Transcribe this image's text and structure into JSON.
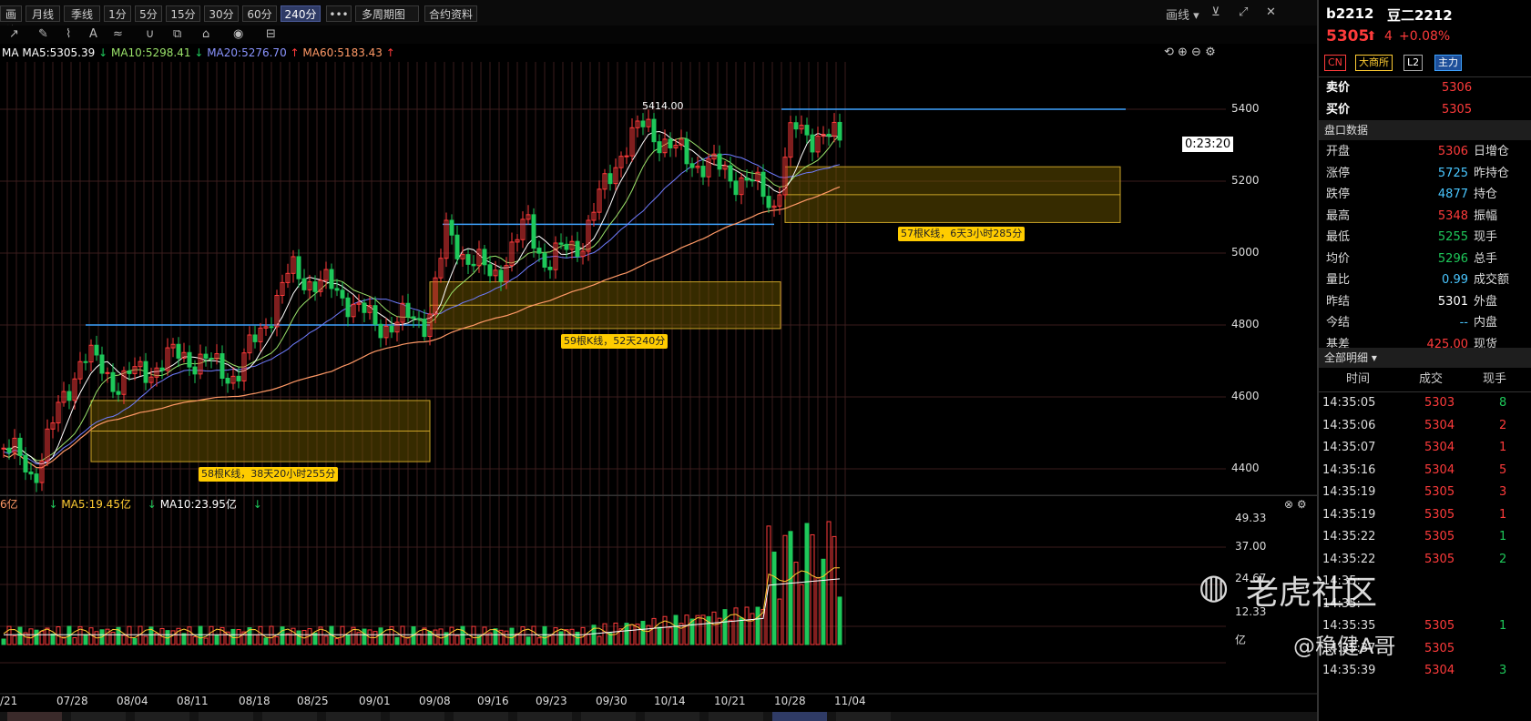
{
  "toolbar": {
    "items": [
      {
        "label": "画线"
      },
      {
        "label": "月线"
      },
      {
        "label": "季线"
      },
      {
        "label": "1分"
      },
      {
        "label": "5分"
      },
      {
        "label": "15分"
      },
      {
        "label": "30分"
      },
      {
        "label": "60分"
      },
      {
        "label": "240分",
        "active": true
      },
      {
        "label": "•••"
      },
      {
        "label": "多周期图"
      },
      {
        "label": "合约资料"
      }
    ],
    "draw_label": "画线",
    "tool_icons": [
      "trend-icon",
      "pen-icon",
      "brush-icon",
      "text-icon",
      "measure-icon",
      "magnet-icon",
      "copy-icon",
      "lock-icon",
      "eye-icon",
      "delete-icon"
    ]
  },
  "ma_bar": {
    "ma_label": "MA",
    "ma5": "MA5:5305.39",
    "ma10": "MA10:5298.41",
    "ma20": "MA20:5276.70",
    "ma60": "MA60:5183.43"
  },
  "colors": {
    "up": "#ff3b3b",
    "down": "#1ec85a",
    "ma5": "#ffffff",
    "ma10": "#9be36a",
    "ma20": "#6f7dff",
    "ma60": "#ff9966",
    "hline": "#3fa3ff",
    "box": "#5a4a00",
    "boxline": "#c9a227"
  },
  "price_axis": {
    "ticks": [
      "5400",
      "5200",
      "5000",
      "4800",
      "4600",
      "4400"
    ]
  },
  "peak_label": "5414.00",
  "countdown": "0:23:20",
  "annotations": {
    "a1": "57根K线，6天3小时285分",
    "a2": "59根K线，52天240分",
    "a3": "58根K线，38天20小时255分"
  },
  "volume": {
    "label_partial": "6亿",
    "ma5": "MA5:19.45亿",
    "ma10": "MA10:23.95亿",
    "ticks": [
      "49.33",
      "37.00",
      "24.67",
      "12.33",
      "亿"
    ]
  },
  "dates": [
    "/21",
    "07/28",
    "08/04",
    "08/11",
    "08/18",
    "08/25",
    "09/01",
    "09/08",
    "09/16",
    "09/23",
    "09/30",
    "10/14",
    "10/21",
    "10/28",
    "11/04"
  ],
  "instrument": {
    "code": "b2212",
    "name": "豆二2212",
    "price": "5305",
    "change": "4",
    "change_pct": "+0.08%",
    "tags": [
      "CN",
      "大商所",
      "L2",
      "主力"
    ]
  },
  "quote": {
    "sell_label": "卖价",
    "sell": "5306",
    "buy_label": "买价",
    "buy": "5305"
  },
  "panel_title": "盘口数据",
  "panel_rows": [
    {
      "k": "开盘",
      "v": "5306",
      "c": "red",
      "k2": "日增仓"
    },
    {
      "k": "涨停",
      "v": "5725",
      "c": "cyan",
      "k2": "昨持仓"
    },
    {
      "k": "跌停",
      "v": "4877",
      "c": "cyan",
      "k2": "持仓"
    },
    {
      "k": "最高",
      "v": "5348",
      "c": "red",
      "k2": "振幅"
    },
    {
      "k": "最低",
      "v": "5255",
      "c": "green",
      "k2": "现手"
    },
    {
      "k": "均价",
      "v": "5296",
      "c": "green",
      "k2": "总手"
    },
    {
      "k": "量比",
      "v": "0.99",
      "c": "cyan",
      "k2": "成交额"
    },
    {
      "k": "昨结",
      "v": "5301",
      "c": "white",
      "k2": "外盘"
    },
    {
      "k": "今结",
      "v": "--",
      "c": "cyan",
      "k2": "内盘"
    },
    {
      "k": "基差",
      "v": "425.00",
      "c": "red",
      "k2": "现货"
    }
  ],
  "detail_title": "全部明细",
  "detail_headers": [
    "时间",
    "成交",
    "现手"
  ],
  "ticks": [
    {
      "t": "14:35:05",
      "p": "5303",
      "q": "8",
      "c": "green"
    },
    {
      "t": "14:35:06",
      "p": "5304",
      "q": "2",
      "c": "red"
    },
    {
      "t": "14:35:07",
      "p": "5304",
      "q": "1",
      "c": "red"
    },
    {
      "t": "14:35:16",
      "p": "5304",
      "q": "5",
      "c": "red"
    },
    {
      "t": "14:35:19",
      "p": "5305",
      "q": "3",
      "c": "red"
    },
    {
      "t": "14:35:19",
      "p": "5305",
      "q": "1",
      "c": "red"
    },
    {
      "t": "14:35:22",
      "p": "5305",
      "q": "1",
      "c": "green"
    },
    {
      "t": "14:35:22",
      "p": "5305",
      "q": "2",
      "c": "green"
    },
    {
      "t": "14:35:",
      "p": "",
      "q": "",
      "c": "red"
    },
    {
      "t": "14:35:",
      "p": "",
      "q": "",
      "c": "red"
    },
    {
      "t": "14:35:35",
      "p": "5305",
      "q": "1",
      "c": "green"
    },
    {
      "t": "14:35:37",
      "p": "5305",
      "q": "",
      "c": "red"
    },
    {
      "t": "14:35:39",
      "p": "5304",
      "q": "3",
      "c": "green"
    }
  ],
  "watermark": {
    "brand": "老虎社区",
    "author": "@稳健A哥"
  }
}
